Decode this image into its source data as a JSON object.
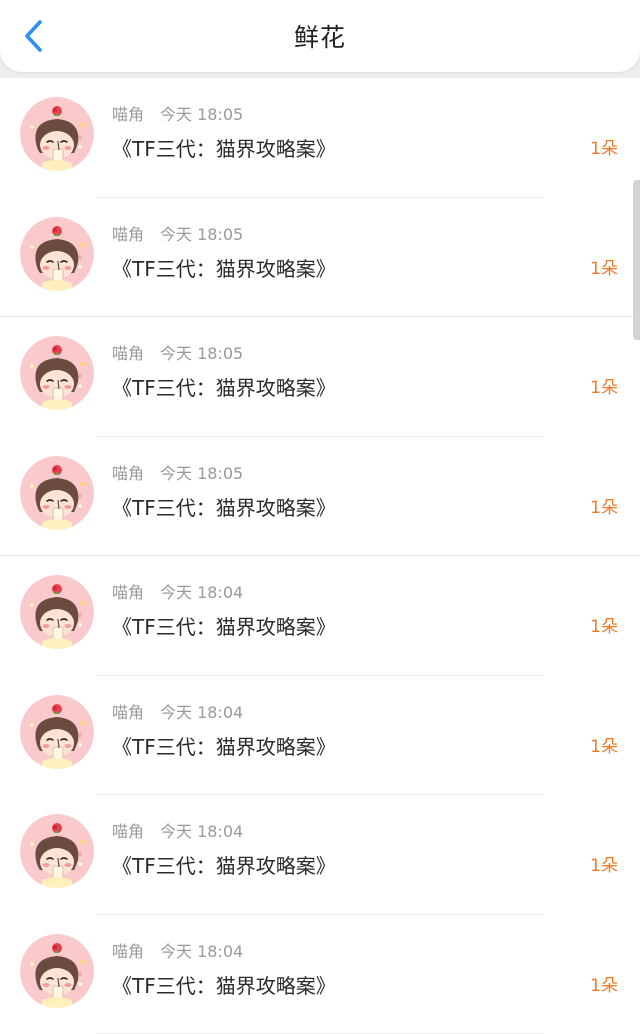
{
  "header": {
    "title": "鲜花"
  },
  "colors": {
    "accent_blue": "#2a8ff7",
    "count_orange": "#f07a2a"
  },
  "icons": {
    "back": "chevron-left-icon",
    "avatar": "cartoon-girl-avatar"
  },
  "gifts": [
    {
      "user": "喵角",
      "time": "今天 18:05",
      "book": "《TF三代：猫界攻略案》",
      "count": "1朵"
    },
    {
      "user": "喵角",
      "time": "今天 18:05",
      "book": "《TF三代：猫界攻略案》",
      "count": "1朵"
    },
    {
      "user": "喵角",
      "time": "今天 18:05",
      "book": "《TF三代：猫界攻略案》",
      "count": "1朵"
    },
    {
      "user": "喵角",
      "time": "今天 18:05",
      "book": "《TF三代：猫界攻略案》",
      "count": "1朵"
    },
    {
      "user": "喵角",
      "time": "今天 18:04",
      "book": "《TF三代：猫界攻略案》",
      "count": "1朵"
    },
    {
      "user": "喵角",
      "time": "今天 18:04",
      "book": "《TF三代：猫界攻略案》",
      "count": "1朵"
    },
    {
      "user": "喵角",
      "time": "今天 18:04",
      "book": "《TF三代：猫界攻略案》",
      "count": "1朵"
    },
    {
      "user": "喵角",
      "time": "今天 18:04",
      "book": "《TF三代：猫界攻略案》",
      "count": "1朵"
    }
  ]
}
